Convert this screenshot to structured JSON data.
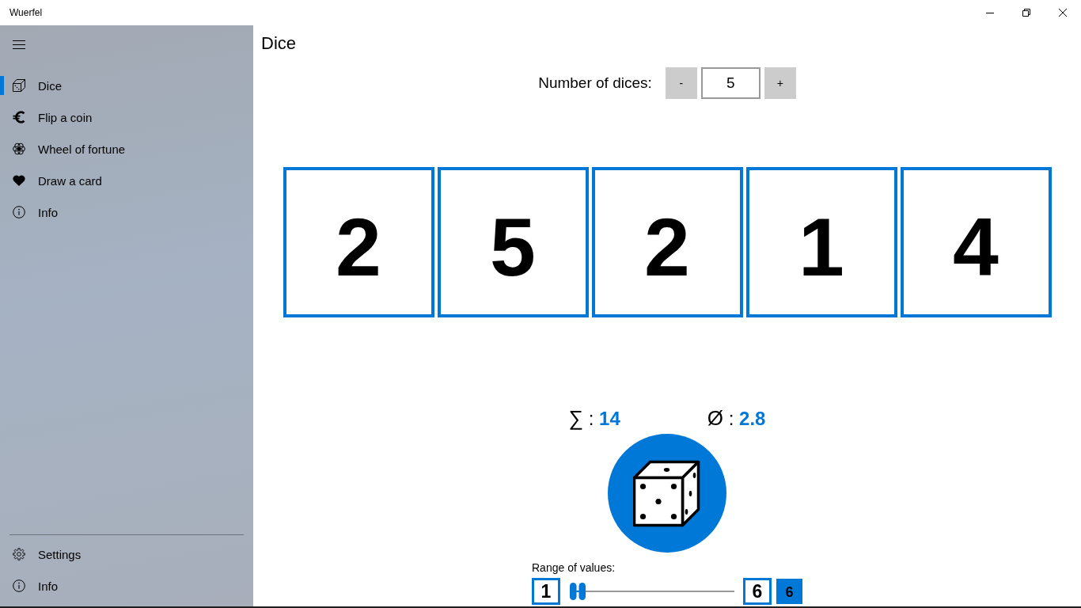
{
  "window": {
    "title": "Wuerfel"
  },
  "sidebar": {
    "items": [
      {
        "label": "Dice",
        "selected": true
      },
      {
        "label": "Flip a coin",
        "selected": false
      },
      {
        "label": "Wheel of fortune",
        "selected": false
      },
      {
        "label": "Draw a card",
        "selected": false
      },
      {
        "label": "Info",
        "selected": false
      }
    ],
    "footer_items": [
      {
        "label": "Settings",
        "selected": false
      },
      {
        "label": "Info",
        "selected": false
      }
    ]
  },
  "page": {
    "title": "Dice"
  },
  "dice_count": {
    "label": "Number of dices:",
    "decrement": "-",
    "value": "5",
    "increment": "+"
  },
  "dice": [
    "2",
    "5",
    "2",
    "1",
    "4"
  ],
  "stats": [
    {
      "symbol": "∑",
      "separator": ":",
      "value": "14"
    },
    {
      "symbol": "Ø",
      "separator": ":",
      "value": "2.8"
    }
  ],
  "range": {
    "label": "Range of values:",
    "min": "1",
    "max": "6",
    "level": 0,
    "value": "6"
  }
}
